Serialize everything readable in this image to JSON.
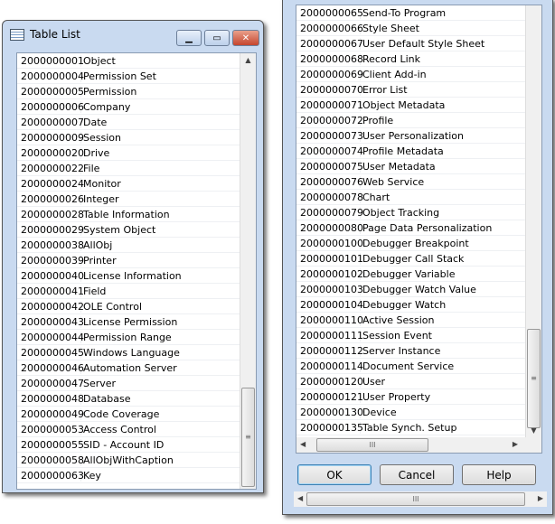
{
  "left_window": {
    "title": "Table List",
    "controls": {
      "minimize": "minimize-icon",
      "maximize": "maximize-icon",
      "close": "close-icon"
    },
    "rows": [
      [
        "2000000001",
        "Object"
      ],
      [
        "2000000004",
        "Permission Set"
      ],
      [
        "2000000005",
        "Permission"
      ],
      [
        "2000000006",
        "Company"
      ],
      [
        "2000000007",
        "Date"
      ],
      [
        "2000000009",
        "Session"
      ],
      [
        "2000000020",
        "Drive"
      ],
      [
        "2000000022",
        "File"
      ],
      [
        "2000000024",
        "Monitor"
      ],
      [
        "2000000026",
        "Integer"
      ],
      [
        "2000000028",
        "Table Information"
      ],
      [
        "2000000029",
        "System Object"
      ],
      [
        "2000000038",
        "AllObj"
      ],
      [
        "2000000039",
        "Printer"
      ],
      [
        "2000000040",
        "License Information"
      ],
      [
        "2000000041",
        "Field"
      ],
      [
        "2000000042",
        "OLE Control"
      ],
      [
        "2000000043",
        "License Permission"
      ],
      [
        "2000000044",
        "Permission Range"
      ],
      [
        "2000000045",
        "Windows Language"
      ],
      [
        "2000000046",
        "Automation Server"
      ],
      [
        "2000000047",
        "Server"
      ],
      [
        "2000000048",
        "Database"
      ],
      [
        "2000000049",
        "Code Coverage"
      ],
      [
        "2000000053",
        "Access Control"
      ],
      [
        "2000000055",
        "SID - Account ID"
      ],
      [
        "2000000058",
        "AllObjWithCaption"
      ],
      [
        "2000000063",
        "Key"
      ]
    ]
  },
  "right_window": {
    "rows": [
      [
        "2000000065",
        "Send-To Program"
      ],
      [
        "2000000066",
        "Style Sheet"
      ],
      [
        "2000000067",
        "User Default Style Sheet"
      ],
      [
        "2000000068",
        "Record Link"
      ],
      [
        "2000000069",
        "Client Add-in"
      ],
      [
        "2000000070",
        "Error List"
      ],
      [
        "2000000071",
        "Object Metadata"
      ],
      [
        "2000000072",
        "Profile"
      ],
      [
        "2000000073",
        "User Personalization"
      ],
      [
        "2000000074",
        "Profile Metadata"
      ],
      [
        "2000000075",
        "User Metadata"
      ],
      [
        "2000000076",
        "Web Service"
      ],
      [
        "2000000078",
        "Chart"
      ],
      [
        "2000000079",
        "Object Tracking"
      ],
      [
        "2000000080",
        "Page Data Personalization"
      ],
      [
        "2000000100",
        "Debugger Breakpoint"
      ],
      [
        "2000000101",
        "Debugger Call Stack"
      ],
      [
        "2000000102",
        "Debugger Variable"
      ],
      [
        "2000000103",
        "Debugger Watch Value"
      ],
      [
        "2000000104",
        "Debugger Watch"
      ],
      [
        "2000000110",
        "Active Session"
      ],
      [
        "2000000111",
        "Session Event"
      ],
      [
        "2000000112",
        "Server Instance"
      ],
      [
        "2000000114",
        "Document Service"
      ],
      [
        "2000000120",
        "User"
      ],
      [
        "2000000121",
        "User Property"
      ],
      [
        "2000000130",
        "Device"
      ],
      [
        "2000000135",
        "Table Synch. Setup"
      ]
    ],
    "buttons": {
      "ok": "OK",
      "cancel": "Cancel",
      "help": "Help"
    }
  }
}
